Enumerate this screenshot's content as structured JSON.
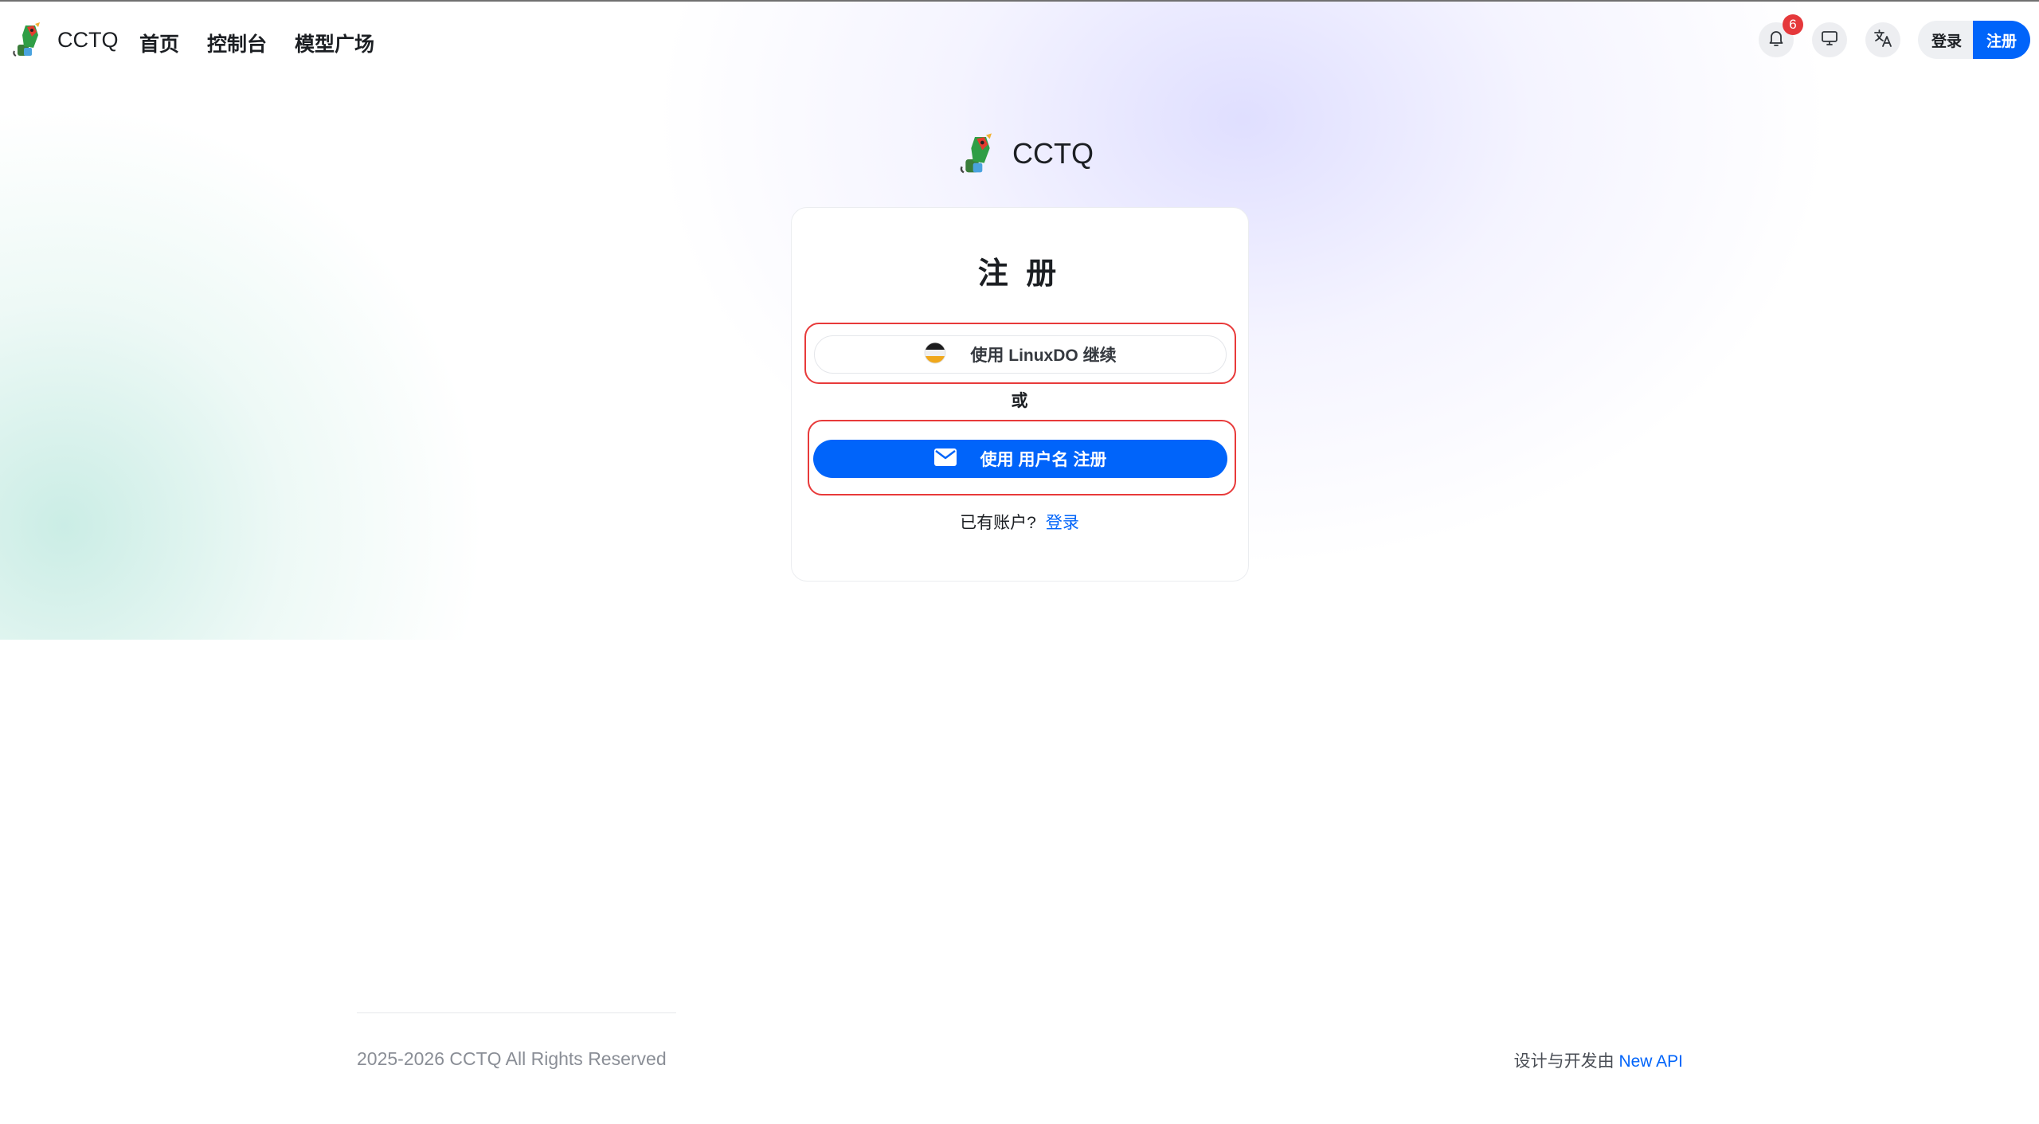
{
  "header": {
    "brand_name": "CCTQ",
    "nav": [
      "首页",
      "控制台",
      "模型广场"
    ],
    "notification_count": "6",
    "login_label": "登录",
    "register_label": "注册"
  },
  "form": {
    "brand_name": "CCTQ",
    "title": "注 册",
    "linuxdo_label": "使用 LinuxDO 继续",
    "or_label": "或",
    "username_register_label": "使用 用户名 注册",
    "has_account_text": "已有账户?",
    "login_link": "登录"
  },
  "footer": {
    "copyright": "2025-2026 CCTQ All Rights Reserved",
    "powered_prefix": "设计与开发由",
    "powered_link": "New API"
  },
  "colors": {
    "primary": "#0064fa",
    "badge": "#e5383b",
    "highlight_outline": "#e83a3a"
  },
  "icons": [
    "bell-icon",
    "monitor-icon",
    "translate-icon",
    "mail-icon",
    "linuxdo-icon",
    "logo-icon"
  ]
}
